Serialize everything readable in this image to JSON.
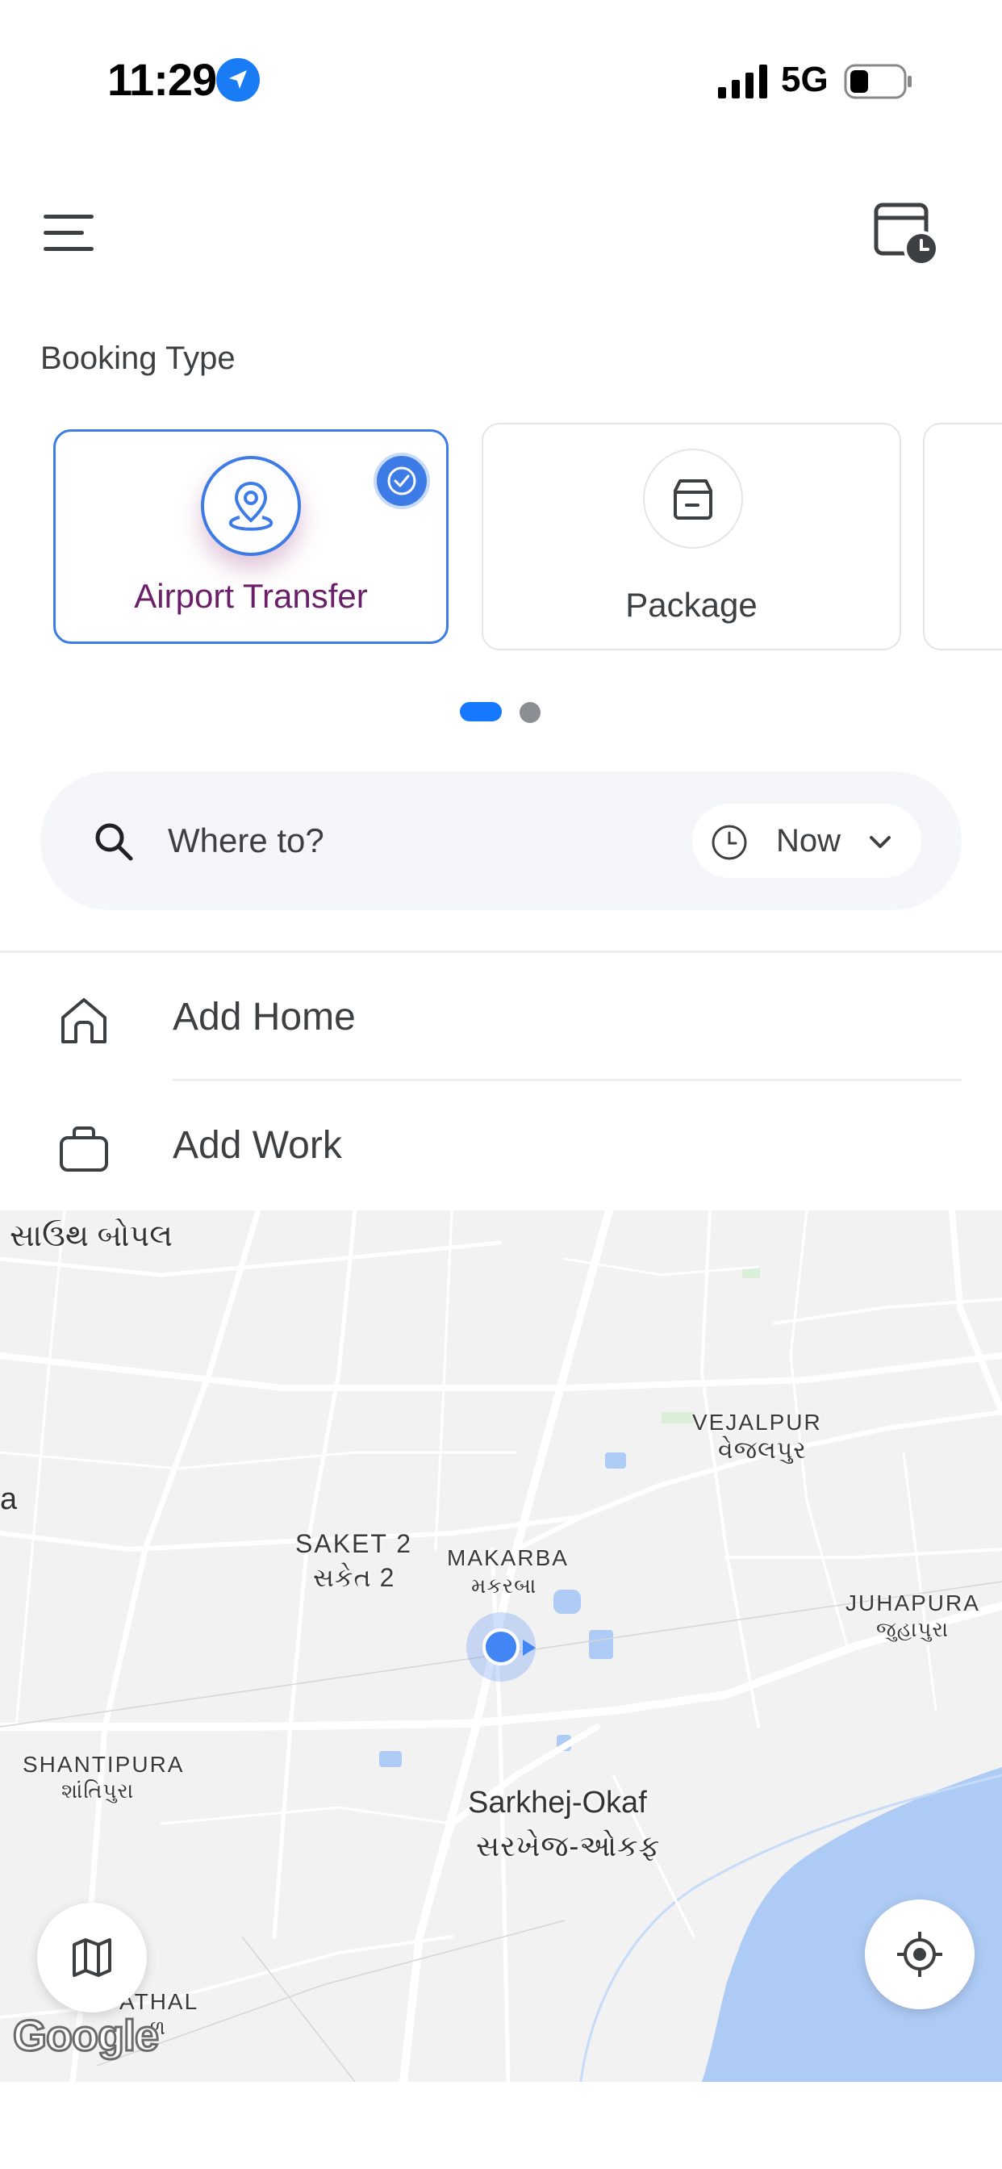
{
  "status_bar": {
    "time": "11:29",
    "network": "5G"
  },
  "header": {
    "menu_icon": "hamburger-menu-icon",
    "history_icon": "calendar-clock-icon"
  },
  "booking": {
    "section_label": "Booking Type",
    "options": [
      {
        "label": "Airport Transfer",
        "icon": "location-pin-icon",
        "selected": true
      },
      {
        "label": "Package",
        "icon": "package-box-icon",
        "selected": false
      }
    ],
    "pager": {
      "pages": 2,
      "current": 1
    }
  },
  "search": {
    "placeholder": "Where to?",
    "when_label": "Now"
  },
  "shortcuts": [
    {
      "label": "Add Home",
      "icon": "home-icon"
    },
    {
      "label": "Add Work",
      "icon": "briefcase-icon"
    }
  ],
  "map": {
    "labels": {
      "south_bopal": "સાઉથ બોપલ",
      "a_edge": "a",
      "vejalpur_en": "VEJALPUR",
      "vejalpur_gu": "વેજલપુર",
      "saket_en": "SAKET 2",
      "saket_gu": "સકેત 2",
      "makarba_en": "MAKARBA",
      "makarba_gu": "મકરબા",
      "juhapura_en": "JUHAPURA",
      "juhapura_gu": "જુહાપુરા",
      "shantipura_en": "SHANTIPURA",
      "shantipura_gu": "શાંતિપુરા",
      "sarkhej_en": "Sarkhej-Okaf",
      "sarkhej_gu": "સરખેજ-ઓકફ",
      "athal": "ATHAL",
      "athal_gu": "ળ"
    },
    "attribution": "Google",
    "layer_button_icon": "map-layers-icon",
    "recenter_button_icon": "crosshair-locate-icon"
  },
  "colors": {
    "accent": "#3d7be6",
    "selected_title": "#6b1f6b",
    "pager_active": "#1677ff"
  }
}
